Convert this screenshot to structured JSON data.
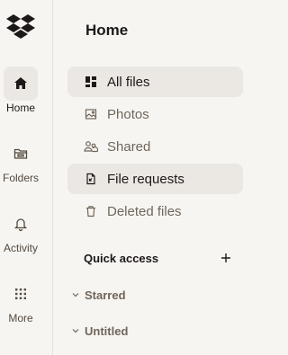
{
  "rail": {
    "items": [
      {
        "label": "Home",
        "icon": "home-icon",
        "active": true
      },
      {
        "label": "Folders",
        "icon": "folder-icon",
        "active": false
      },
      {
        "label": "Activity",
        "icon": "bell-icon",
        "active": false
      },
      {
        "label": "More",
        "icon": "grid-icon",
        "active": false
      }
    ]
  },
  "main": {
    "title": "Home",
    "nav": [
      {
        "label": "All files",
        "icon": "all-files-icon",
        "selected": true
      },
      {
        "label": "Photos",
        "icon": "photo-icon",
        "selected": false
      },
      {
        "label": "Shared",
        "icon": "shared-icon",
        "selected": false
      },
      {
        "label": "File requests",
        "icon": "file-request-icon",
        "selected": true
      },
      {
        "label": "Deleted files",
        "icon": "trash-icon",
        "selected": false
      }
    ],
    "quick_access": {
      "title": "Quick access",
      "add_icon": "plus-icon",
      "groups": [
        {
          "label": "Starred",
          "icon": "chevron-down-icon"
        },
        {
          "label": "Untitled",
          "icon": "chevron-down-icon"
        }
      ]
    }
  },
  "colors": {
    "background": "#f7f5f2",
    "selected_bg": "#ebe8e3",
    "text": "#1e1919",
    "muted": "#6f665a"
  }
}
